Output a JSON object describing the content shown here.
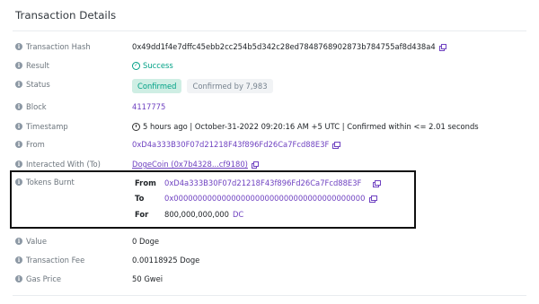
{
  "title": "Transaction Details",
  "rows": {
    "tx_hash": {
      "label": "Transaction Hash",
      "value": "0x49dd1f4e7dffc45ebb2cc254b5d342c28ed7848768902873b784755af8d438a4"
    },
    "result": {
      "label": "Result",
      "value": "Success"
    },
    "status": {
      "label": "Status",
      "badge": "Confirmed",
      "confirmations": "Confirmed by 7,983"
    },
    "block": {
      "label": "Block",
      "value": "4117775"
    },
    "timestamp": {
      "label": "Timestamp",
      "value": "5 hours ago | October-31-2022 09:20:16 AM +5 UTC | Confirmed within <= 2.01 seconds"
    },
    "from": {
      "label": "From",
      "value": "0xD4a333B30F07d21218F43f896Fd26Ca7Fcd88E3F"
    },
    "interacted": {
      "label": "Interacted With (To)",
      "value": "DogeCoin (0x7b4328...cf9180)"
    },
    "tokens_burnt": {
      "label": "Tokens Burnt",
      "from_label": "From",
      "from_value": "0xD4a333B30F07d21218F43f896Fd26Ca7Fcd88E3F",
      "to_label": "To",
      "to_value": "0x0000000000000000000000000000000000000000",
      "for_label": "For",
      "for_amount": "800,000,000,000",
      "for_token": "DC"
    },
    "value": {
      "label": "Value",
      "value": "0 Doge"
    },
    "fee": {
      "label": "Transaction Fee",
      "value": "0.00118925 Doge"
    },
    "gas": {
      "label": "Gas Price",
      "value": "50 Gwei"
    }
  },
  "colors": {
    "link": "#6f42c1",
    "success": "#00a186",
    "highlight_box": "#111111"
  },
  "icons": {
    "info": "info-circle-icon",
    "copy": "copy-icon",
    "check": "check-circle-icon",
    "clock": "clock-icon"
  }
}
